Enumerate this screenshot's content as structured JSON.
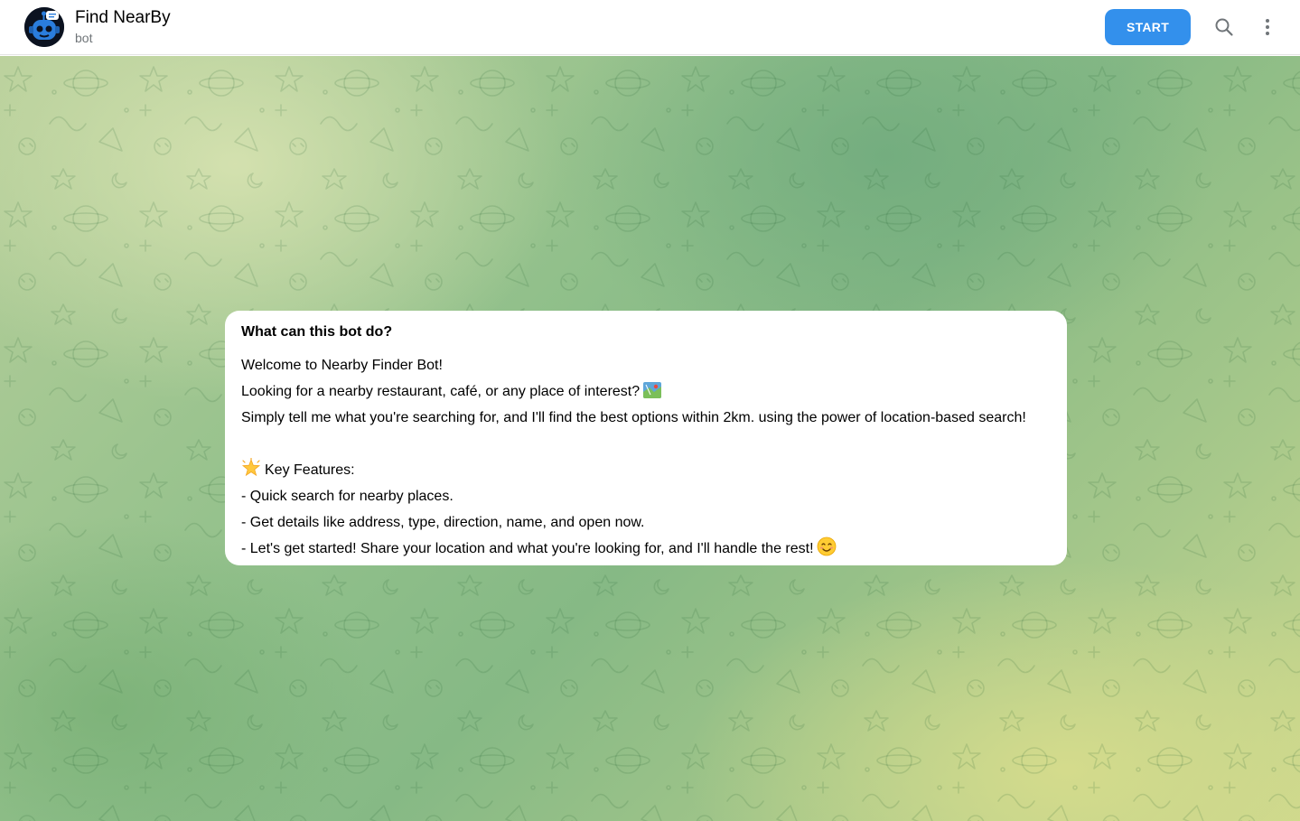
{
  "header": {
    "title": "Find NearBy",
    "subtitle": "bot",
    "start_label": "START",
    "icons": [
      "robot-avatar-icon",
      "search-icon",
      "more-vertical-icon"
    ]
  },
  "card": {
    "heading": "What can this bot do?",
    "lines": [
      "Welcome to Nearby Finder Bot!",
      "Looking for a nearby restaurant, café, or any place of interest?",
      "Simply tell me what you're searching for, and I'll find the best options within 2km. using the power of location-based search!",
      "",
      "Key Features:",
      "- Quick search for nearby places.",
      "- Get details like address, type, direction, name, and open now.",
      "- Let's get started! Share your location and what you're looking for, and I'll handle the rest!"
    ],
    "emoji_icons": [
      "map-emoji-icon",
      "glowing-star-emoji-icon",
      "smiling-face-emoji-icon"
    ]
  },
  "colors": {
    "accent": "#3390ec",
    "card_background": "#ffffff",
    "header_background": "#ffffff",
    "subtitle_text": "#707579"
  }
}
